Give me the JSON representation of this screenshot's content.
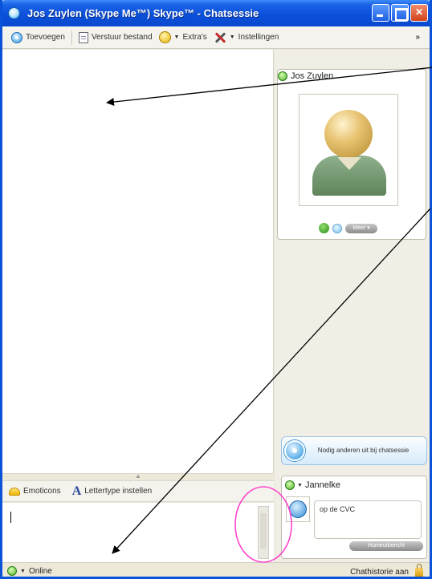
{
  "window": {
    "title": "Jos Zuylen (Skype Me™) Skype™ - Chatsessie"
  },
  "toolbar": {
    "add_label": "Toevoegen",
    "send_file_label": "Verstuur bestand",
    "extras_label": "Extra's",
    "settings_label": "Instellingen",
    "more_label": "»"
  },
  "contact": {
    "name": "Jos Zuylen",
    "button_label": "Meer ▾"
  },
  "invite": {
    "label": "Nodig anderen uit bij chatsessie"
  },
  "me": {
    "name": "Jannelke",
    "mood": "op de CVC",
    "mood_button": "Humeurbericht"
  },
  "format_bar": {
    "emoticons_label": "Emoticons",
    "font_label": "Lettertype instellen"
  },
  "statusbar": {
    "status": "Online",
    "history_label": "Chathistorie aan"
  },
  "colors": {
    "titlebar": "#0b4fd9",
    "annotation_circle": "#ff44cc"
  }
}
